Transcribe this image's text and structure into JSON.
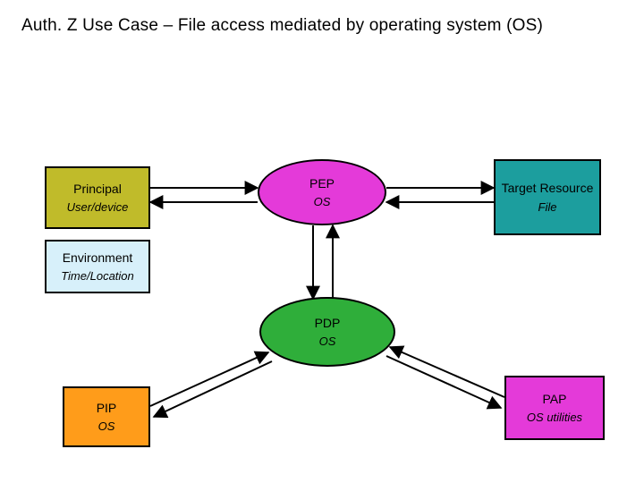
{
  "title": "Auth. Z Use Case – File access mediated by operating system (OS)",
  "principal": {
    "label": "Principal",
    "sub": "User/device"
  },
  "pep": {
    "label": "PEP",
    "sub": "OS"
  },
  "target": {
    "label": "Target Resource",
    "sub": "File"
  },
  "env": {
    "label": "Environment",
    "sub": "Time/Location"
  },
  "pdp": {
    "label": "PDP",
    "sub": "OS"
  },
  "pip": {
    "label": "PIP",
    "sub": "OS"
  },
  "pap": {
    "label": "PAP",
    "sub": "OS utilities"
  }
}
